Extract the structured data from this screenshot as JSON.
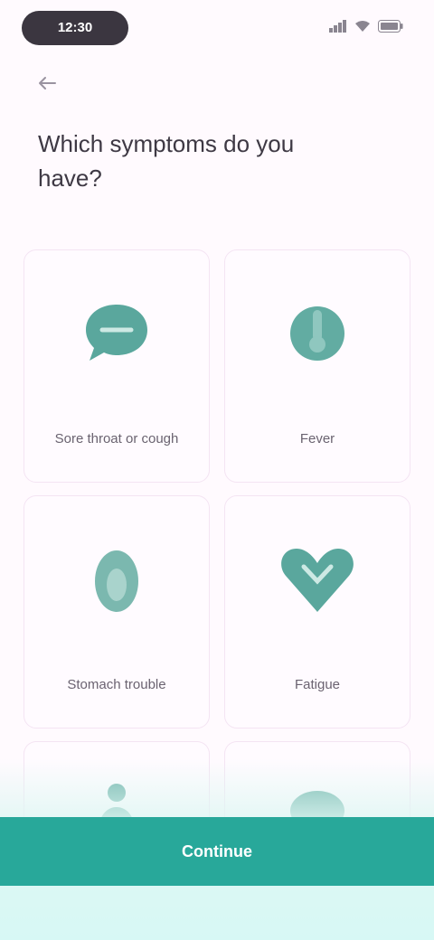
{
  "status_bar": {
    "time": "12:30",
    "wifi_icon": "wifi-icon",
    "signal_icon": "signal-icon",
    "battery_icon": "battery-icon"
  },
  "header": {
    "back_icon": "arrow-left-icon",
    "title": "Which symptoms do you have?"
  },
  "options": [
    {
      "icon": "chat-bubble-icon",
      "label": "Sore throat or cough"
    },
    {
      "icon": "thermometer-icon",
      "label": "Fever"
    },
    {
      "icon": "egg-icon",
      "label": "Stomach trouble"
    },
    {
      "icon": "heart-icon",
      "label": "Fatigue"
    },
    {
      "icon": "body-icon",
      "label": ""
    },
    {
      "icon": "head-icon",
      "label": ""
    }
  ],
  "footer": {
    "continue_label": "Continue"
  },
  "colors": {
    "accent": "#28a89a",
    "icon": "#5aa79d",
    "background": "#fffafe"
  }
}
